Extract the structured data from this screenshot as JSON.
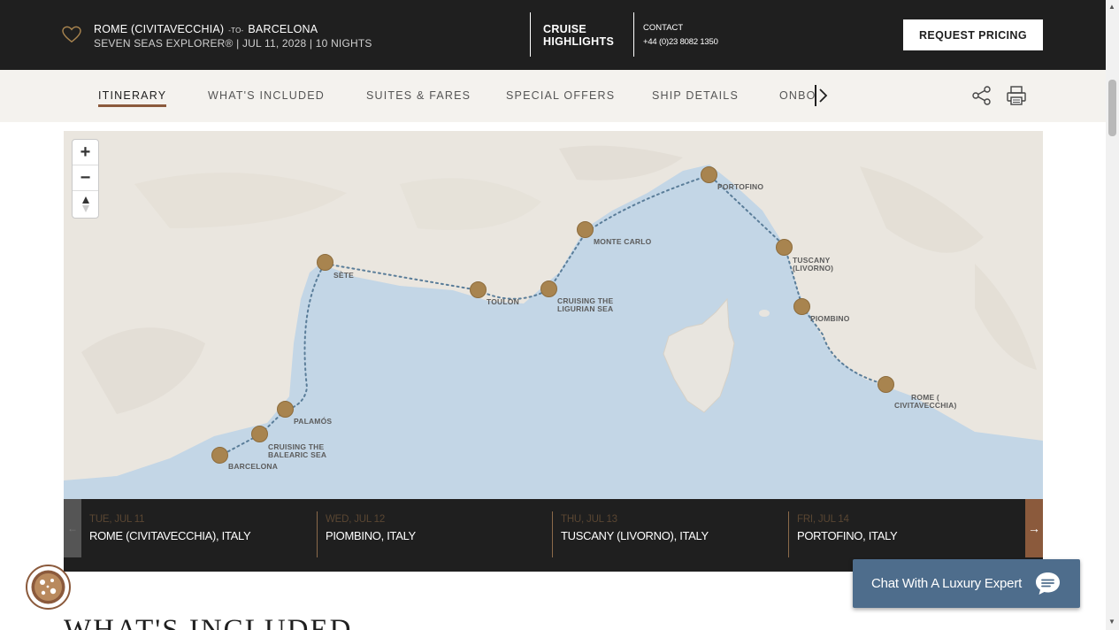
{
  "header": {
    "origin": "ROME (CIVITAVECCHIA)",
    "to": "-TO-",
    "destination": "BARCELONA",
    "voyage_info": "SEVEN SEAS EXPLORER®  |  JUL 11, 2028  |  10 NIGHTS",
    "highlights_line1": "CRUISE",
    "highlights_line2": "HIGHLIGHTS",
    "contact_label": "CONTACT",
    "contact_phone": "+44 (0)23 8082 1350",
    "request_button": "REQUEST PRICING"
  },
  "tabs": [
    {
      "label": "ITINERARY",
      "active": true
    },
    {
      "label": "WHAT'S INCLUDED",
      "active": false
    },
    {
      "label": "SUITES & FARES",
      "active": false
    },
    {
      "label": "SPECIAL OFFERS",
      "active": false
    },
    {
      "label": "SHIP DETAILS",
      "active": false
    },
    {
      "label": "ONBOARD",
      "active": false
    }
  ],
  "map": {
    "zoom_in": "+",
    "zoom_out": "−",
    "ports": [
      {
        "name": "PORTOFINO"
      },
      {
        "name": "MONTE CARLO"
      },
      {
        "name": "TUSCANY (LIVORNO)"
      },
      {
        "name": "SÈTE"
      },
      {
        "name": "TOULON"
      },
      {
        "name": "CRUISING THE LIGURIAN SEA"
      },
      {
        "name": "PIOMBINO"
      },
      {
        "name": "ROME ( CIVITAVECCHIA)"
      },
      {
        "name": "PALAMÓS"
      },
      {
        "name": "CRUISING THE BALEARIC SEA"
      },
      {
        "name": "BARCELONA"
      }
    ]
  },
  "days": [
    {
      "date": "TUE, JUL 11",
      "port": "ROME (CIVITAVECCHIA), ITALY"
    },
    {
      "date": "WED, JUL 12",
      "port": "PIOMBINO, ITALY"
    },
    {
      "date": "THU, JUL 13",
      "port": "TUSCANY (LIVORNO), ITALY"
    },
    {
      "date": "FRI, JUL 14",
      "port": "PORTOFINO, ITALY"
    }
  ],
  "strip": {
    "prev": "←",
    "next": "→"
  },
  "section_heading": "WHAT'S INCLUDED",
  "chat": {
    "label": "Chat With A Luxury Expert"
  },
  "scrollbar": {
    "up": "▲",
    "down": "▼"
  },
  "colors": {
    "accent": "#8b5a3c",
    "port_dot": "#a8844f",
    "dark": "#1f1f1f",
    "sea": "#c3d6e6",
    "chat": "#4e6d8c"
  }
}
